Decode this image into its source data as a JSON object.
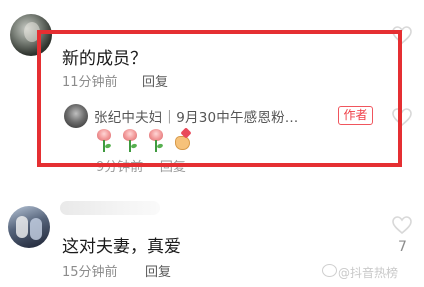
{
  "comments": [
    {
      "text": "新的成员？",
      "time": "11分钟前",
      "reply_label": "回复",
      "reply": {
        "name": "张纪中夫妇｜9月30中午感恩粉…",
        "badge": "作者",
        "emoji": [
          "rose",
          "rose",
          "rose",
          "heart-hand"
        ],
        "time_partial": "9分钟前",
        "reply_label": "回复"
      }
    },
    {
      "text": "这对夫妻，真爱",
      "time": "15分钟前",
      "reply_label": "回复",
      "like_count": "7"
    }
  ],
  "watermark": "@抖音热榜",
  "colors": {
    "highlight": "#e52f32",
    "author_badge": "#ef3e47"
  }
}
